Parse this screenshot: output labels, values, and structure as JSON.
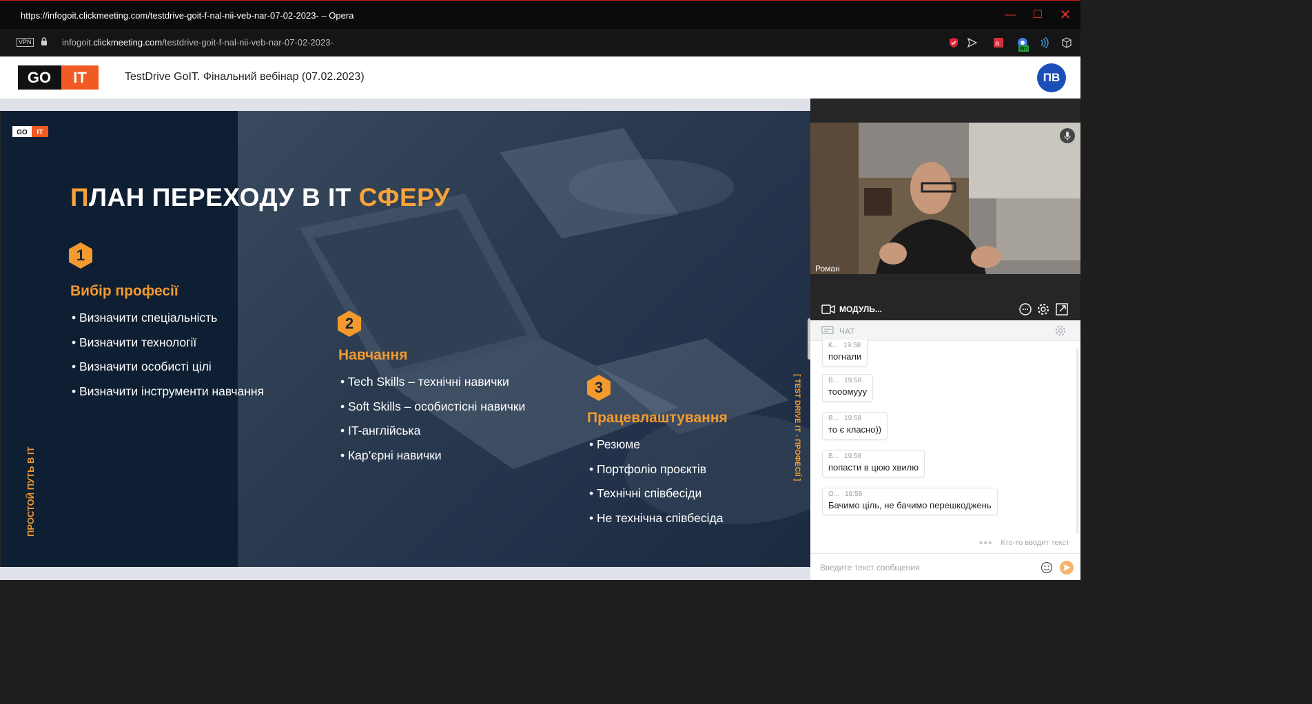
{
  "window": {
    "title": "https://infogoit.clickmeeting.com/testdrive-goit-f-nal-nii-veb-nar-07-02-2023- – Opera"
  },
  "address_bar": {
    "vpn_label": "VPN",
    "url_prefix": "infogoit.",
    "url_domain": "clickmeeting.com",
    "url_path": "/testdrive-goit-f-nal-nii-veb-nar-07-02-2023-",
    "badge_count": "8m"
  },
  "header": {
    "logo_left": "GO",
    "logo_right": "IT",
    "webinar_title": "TestDrive GoIT. Фінальний вебінар (07.02.2023)",
    "avatar_initials": "ПВ"
  },
  "slide": {
    "logo_left": "GO",
    "logo_right": "IT",
    "title_first_letter": "П",
    "title_middle": "ЛАН ПЕРЕХОДУ В IT ",
    "title_highlight": "СФЕРУ",
    "steps": [
      {
        "number": "1",
        "heading": "Вибір професії",
        "items": [
          "• Визначити спеціальність",
          "• Визначити технології",
          "• Визначити особисті цілі",
          "• Визначити інструменти навчання"
        ]
      },
      {
        "number": "2",
        "heading": "Навчання",
        "items": [
          "• Tech Skills – технічні навички",
          "• Soft Skills – особистісні навички",
          "• IT-англійська",
          "• Кар’єрні навички"
        ]
      },
      {
        "number": "3",
        "heading": "Працевлаштування",
        "items": [
          "• Резюме",
          "• Портфоліо проєктів",
          "• Технічні співбесіди",
          "• Не технічна співбесіда"
        ]
      }
    ],
    "vertical_left": "ПРОСТОЙ ПУТЬ В IT",
    "vertical_right": "[ TEST DRIVE IT - ПРОФЕСІЇ ]"
  },
  "video": {
    "presenter_name": "Роман"
  },
  "modules_bar": {
    "label": "МОДУЛЬ..."
  },
  "chat": {
    "header_label": "ЧАТ",
    "messages": [
      {
        "author": "К...",
        "time": "19:58",
        "text": "погнали"
      },
      {
        "author": "В...",
        "time": "19:58",
        "text": "тооомууу"
      },
      {
        "author": "В...",
        "time": "19:58",
        "text": "то є класно))"
      },
      {
        "author": "В...",
        "time": "19:58",
        "text": "попасти в цюю хвилю"
      },
      {
        "author": "О...",
        "time": "19:58",
        "text": "Бачимо ціль, не бачимо перешкоджень"
      }
    ],
    "typing_indicator": "Кто-то вводит текст",
    "input_placeholder": "Введите текст сообщения"
  },
  "colors": {
    "accent_orange": "#f39a2e",
    "avatar_blue": "#1b4fb8",
    "window_close_red": "#e0322e"
  }
}
